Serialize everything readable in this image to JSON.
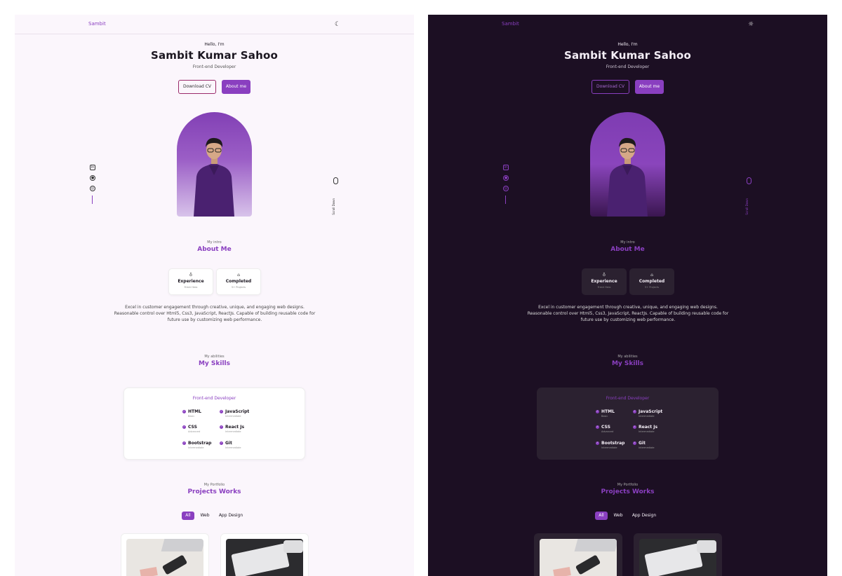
{
  "header": {
    "logo": "Sambit"
  },
  "hero": {
    "greeting": "Hello, I'm",
    "name": "Sambit Kumar Sahoo",
    "role": "Front-end Developer",
    "btn_cv": "Download CV",
    "btn_about": "About me",
    "scroll_text": "Scroll Down"
  },
  "about": {
    "subtitle": "My intro",
    "title": "About Me",
    "cards": [
      {
        "title": "Experience",
        "sub": "Fresh Hero",
        "icon": "award-icon"
      },
      {
        "title": "Completed",
        "sub": "5+ Projects",
        "icon": "briefcase-icon"
      }
    ],
    "text": "Excel in customer engagement through creative, unique, and engaging web designs. Reasonable control over Html5, Css3, JavaScript, ReactJs. Capable of building reusable code for future use by customizing web performance."
  },
  "skills": {
    "subtitle": "My abilities",
    "title": "My Skills",
    "card_title": "Front-end Developer",
    "items": [
      {
        "name": "HTML",
        "level": "Basic"
      },
      {
        "name": "JavaScript",
        "level": "Intermediate"
      },
      {
        "name": "CSS",
        "level": "Advanced"
      },
      {
        "name": "React Js",
        "level": "Intermediate"
      },
      {
        "name": "Bootstrap",
        "level": "Intermediate"
      },
      {
        "name": "Git",
        "level": "Intermediate"
      }
    ]
  },
  "portfolio": {
    "subtitle": "My Portfolio",
    "title": "Projects Works",
    "filters": [
      "All",
      "Web",
      "App Design"
    ]
  },
  "colors": {
    "accent": "#8a3fc0",
    "light_bg": "#fbf6fc",
    "dark_bg": "#1c0f23"
  }
}
